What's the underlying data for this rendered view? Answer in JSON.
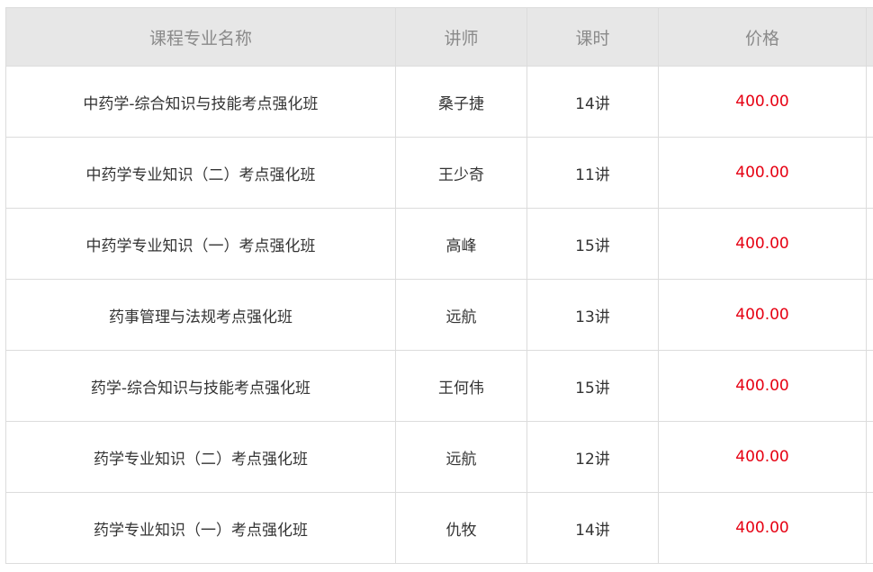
{
  "table": {
    "headers": [
      "课程专业名称",
      "讲师",
      "课时",
      "价格"
    ],
    "rows": [
      {
        "course": "中药学-综合知识与技能考点强化班",
        "teacher": "桑子捷",
        "hours": "14讲",
        "price": "400.00"
      },
      {
        "course": "中药学专业知识（二）考点强化班",
        "teacher": "王少奇",
        "hours": "11讲",
        "price": "400.00"
      },
      {
        "course": "中药学专业知识（一）考点强化班",
        "teacher": "高峰",
        "hours": "15讲",
        "price": "400.00"
      },
      {
        "course": "药事管理与法规考点强化班",
        "teacher": "远航",
        "hours": "13讲",
        "price": "400.00"
      },
      {
        "course": "药学-综合知识与技能考点强化班",
        "teacher": "王何伟",
        "hours": "15讲",
        "price": "400.00"
      },
      {
        "course": "药学专业知识（二）考点强化班",
        "teacher": "远航",
        "hours": "12讲",
        "price": "400.00"
      },
      {
        "course": "药学专业知识（一）考点强化班",
        "teacher": "仇牧",
        "hours": "14讲",
        "price": "400.00"
      }
    ]
  },
  "colors": {
    "header_bg": "#e7e7e7",
    "header_text": "#8a8a8a",
    "body_text": "#333333",
    "price": "#e60012",
    "border": "#dcdcdc"
  }
}
